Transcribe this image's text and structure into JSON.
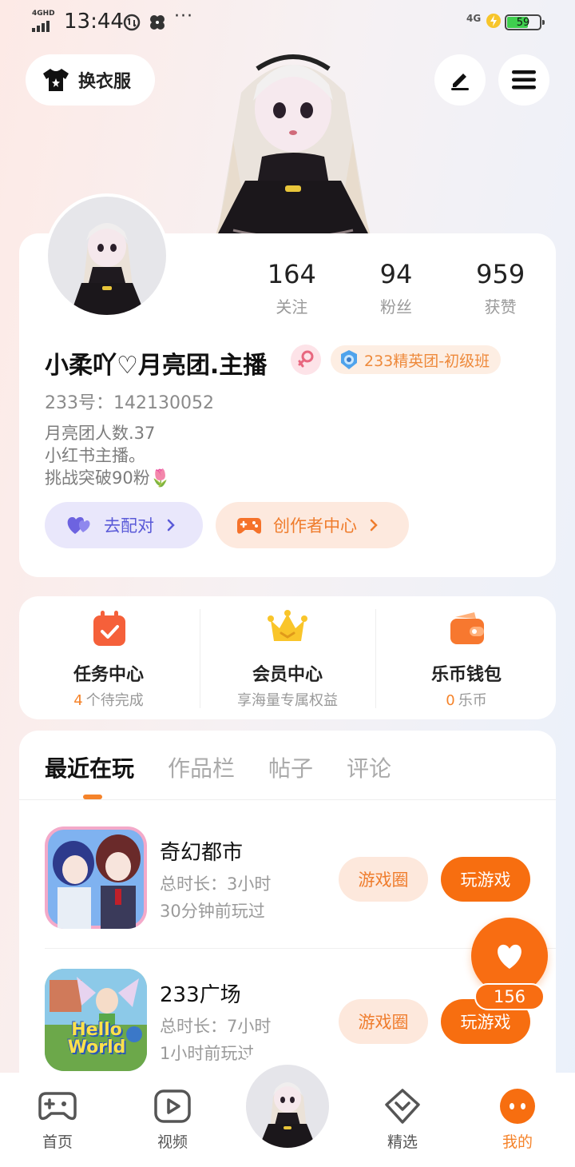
{
  "status_bar": {
    "network": "4GHD",
    "time": "13:44",
    "more": "···",
    "cell": "4G",
    "battery": "59"
  },
  "header": {
    "dress_label": "换衣服",
    "icons": [
      "tshirt-icon",
      "edit-icon",
      "menu-icon"
    ]
  },
  "profile": {
    "stats": [
      {
        "num": "164",
        "label": "关注"
      },
      {
        "num": "94",
        "label": "粉丝"
      },
      {
        "num": "959",
        "label": "获赞"
      }
    ],
    "nickname": "小柔吖♡月亮团.主播",
    "team_badge": "233精英团-初级班",
    "uid": "233号：142130052",
    "bio": [
      "月亮团人数.37",
      "小红书主播。",
      "挑战突破90粉🌷"
    ],
    "match_label": "去配对",
    "creator_label": "创作者中心"
  },
  "quick_menu": [
    {
      "title": "任务中心",
      "count": "4",
      "sub": "个待完成"
    },
    {
      "title": "会员中心",
      "count": "",
      "sub": "享海量专属权益"
    },
    {
      "title": "乐币钱包",
      "count": "0",
      "sub": "乐币"
    }
  ],
  "tabs": [
    "最近在玩",
    "作品栏",
    "帖子",
    "评论"
  ],
  "games": [
    {
      "name": "奇幻都市",
      "duration": "总时长：3小时",
      "last_played": "30分钟前玩过",
      "circle_label": "游戏圈",
      "play_label": "玩游戏"
    },
    {
      "name": "233广场",
      "duration": "总时长：7小时",
      "last_played": "1小时前玩过",
      "circle_label": "游戏圈",
      "play_label": "玩游戏",
      "icon_text": [
        "Hello",
        "World"
      ]
    }
  ],
  "like": {
    "count": "156"
  },
  "bottom_nav": [
    {
      "label": "首页"
    },
    {
      "label": "视频"
    },
    {
      "label": "精选"
    },
    {
      "label": "我的"
    }
  ],
  "colors": {
    "accent": "#f76e10",
    "accent_light": "#fde8dc",
    "match_purple": "#5a5ad8",
    "battery_green": "#3fcf4e"
  }
}
